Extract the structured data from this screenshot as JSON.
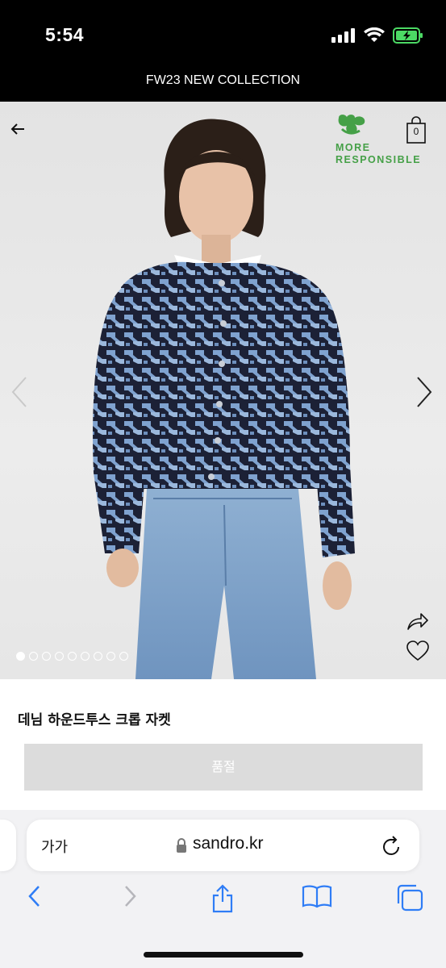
{
  "status_bar": {
    "time": "5:54"
  },
  "promo": {
    "text": "FW23 NEW COLLECTION"
  },
  "badge": {
    "line1": "MORE",
    "line2": "RESPONSIBLE"
  },
  "cart": {
    "count": "0"
  },
  "gallery": {
    "image_count": 9,
    "active_index": 0
  },
  "product": {
    "name": "데님 하운드투스 크롭 자켓",
    "button_label": "품절"
  },
  "browser": {
    "text_size_label": "가가",
    "url": "sandro.kr"
  },
  "colors": {
    "badge_green": "#45a047",
    "link_blue": "#2f7df6",
    "soldout_gray": "#dcdcdc"
  }
}
